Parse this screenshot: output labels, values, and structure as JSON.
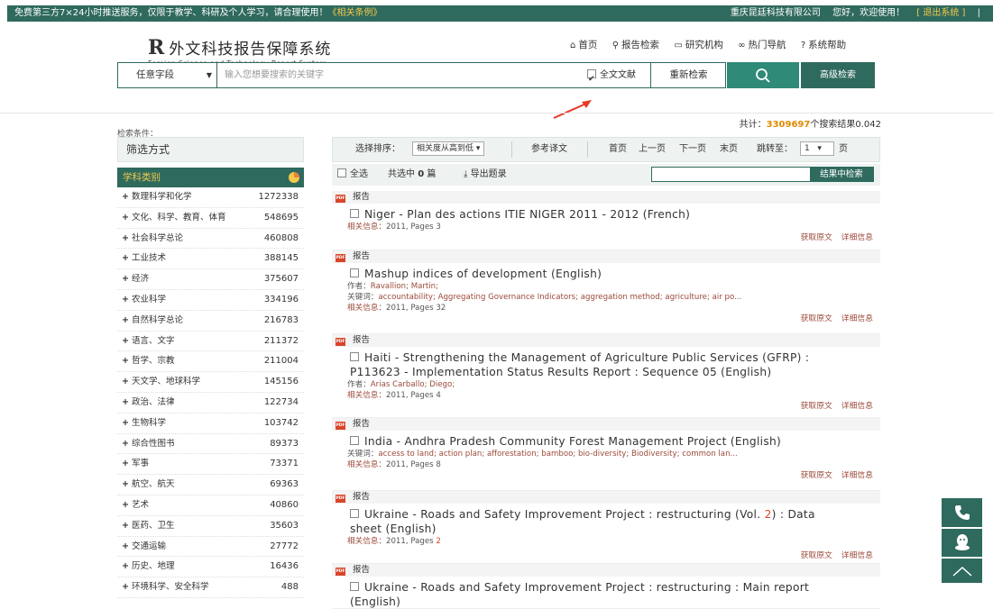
{
  "topbar": {
    "notice": "免费第三方7×24小时推送服务，仅限于教学、科研及个人学习，请合理使用！",
    "notice_link": "《相关条例》",
    "company": "重庆昆廷科技有限公司",
    "welcome": "您好，欢迎使用！",
    "logout": "[ 退出系统 ]",
    "pipe": "|"
  },
  "logo": {
    "mark": "R",
    "title": "外文科技报告保障系统",
    "subtitle": "Foreign Science and Technology Report System"
  },
  "nav": [
    {
      "icon": "home-icon",
      "glyph": "⌂",
      "label": "首页"
    },
    {
      "icon": "search-icon",
      "glyph": "⚲",
      "label": "报告检索"
    },
    {
      "icon": "monitor-icon",
      "glyph": "▭",
      "label": "研究机构"
    },
    {
      "icon": "link-icon",
      "glyph": "∞",
      "label": "热门导航"
    },
    {
      "icon": "help-icon",
      "glyph": "?",
      "label": "系统帮助"
    }
  ],
  "search": {
    "field": "任意字段",
    "placeholder": "输入您想要搜索的关键字",
    "fulltext_label": "全文文献",
    "fulltext_checked": true,
    "retry": "重新检索",
    "advanced": "高级检索"
  },
  "total": {
    "prefix": "共计：",
    "count": "3309697",
    "suffix": "个搜索结果0.042"
  },
  "conditions_label": "检索条件：",
  "sidebar": {
    "filter_title": "筛选方式",
    "category_title": "学科类别",
    "categories": [
      {
        "name": "数理科学和化学",
        "count": "1272338"
      },
      {
        "name": "文化、科学、教育、体育",
        "count": "548695"
      },
      {
        "name": "社会科学总论",
        "count": "460808"
      },
      {
        "name": "工业技术",
        "count": "388145"
      },
      {
        "name": "经济",
        "count": "375607"
      },
      {
        "name": "农业科学",
        "count": "334196"
      },
      {
        "name": "自然科学总论",
        "count": "216783"
      },
      {
        "name": "语言、文字",
        "count": "211372"
      },
      {
        "name": "哲学、宗教",
        "count": "211004"
      },
      {
        "name": "天文学、地球科学",
        "count": "145156"
      },
      {
        "name": "政治、法律",
        "count": "122734"
      },
      {
        "name": "生物科学",
        "count": "103742"
      },
      {
        "name": "综合性图书",
        "count": "89373"
      },
      {
        "name": "军事",
        "count": "73371"
      },
      {
        "name": "航空、航天",
        "count": "69363"
      },
      {
        "name": "艺术",
        "count": "40860"
      },
      {
        "name": "医药、卫生",
        "count": "35603"
      },
      {
        "name": "交通运输",
        "count": "27772"
      },
      {
        "name": "历史、地理",
        "count": "16436"
      },
      {
        "name": "环境科学、安全科学",
        "count": "488"
      }
    ]
  },
  "sortbar": {
    "label": "选择排序：",
    "selected": "相关度从高到低",
    "ref": "参考译文",
    "first": "首页",
    "prev": "上一页",
    "next": "下一页",
    "last": "末页",
    "goto": "跳转至：",
    "page": "1",
    "page_unit": "页"
  },
  "actionbar": {
    "select_all": "全选",
    "selected_prefix": "共选中",
    "selected_count": "0",
    "selected_suffix": "篇",
    "export": "导出题录",
    "search_in_results": "结果中检索"
  },
  "results": [
    {
      "tag": "报告",
      "title": "Niger - Plan des actions ITIE NIGER 2011 - 2012 (French)",
      "info_label": "相关信息：",
      "info": "2011, Pages 3"
    },
    {
      "tag": "报告",
      "title": "Mashup indices of development (English)",
      "author_label": "作者：",
      "authors": "Ravallion;  Martin;",
      "kw_label": "关键词：",
      "keywords": "accountability;  Aggregating Governance Indicators;  aggregation method;  agriculture;  air po...",
      "info_label": "相关信息：",
      "info": "2011, Pages 32"
    },
    {
      "tag": "报告",
      "title": "Haiti - Strengthening the Management of Agriculture Public Services (GFRP) :",
      "title2": "P113623 - Implementation Status Results Report : Sequence 05 (English)",
      "author_label": "作者：",
      "authors": "Arias Carballo;  Diego;",
      "info_label": "相关信息：",
      "info": "2011, Pages 4"
    },
    {
      "tag": "报告",
      "title": "India - Andhra Pradesh Community Forest Management Project (English)",
      "kw_label": "关键词：",
      "keywords": "access to land;  action plan;  afforestation;  bamboo;  bio-diversity;  Biodiversity;  common lan...",
      "info_label": "相关信息：",
      "info": "2011, Pages 8"
    },
    {
      "tag": "报告",
      "title_a": "Ukraine - Roads and Safety Improvement Project : restructuring (Vol. ",
      "title_num": "2",
      "title_b": ") : Data",
      "title2": "sheet (English)",
      "info_label": "相关信息：",
      "info": "2011, Pages ",
      "info_num": "2"
    },
    {
      "tag": "报告",
      "title": "Ukraine - Roads and Safety Improvement Project : restructuring : Main report",
      "title2": "(English)"
    }
  ],
  "result_links": {
    "fetch": "获取原文",
    "detail": "详细信息"
  },
  "colors": {
    "primary": "#2f6a5e",
    "accent": "#f3c94a",
    "count": "#e08a00",
    "pdf": "#d9452b"
  }
}
